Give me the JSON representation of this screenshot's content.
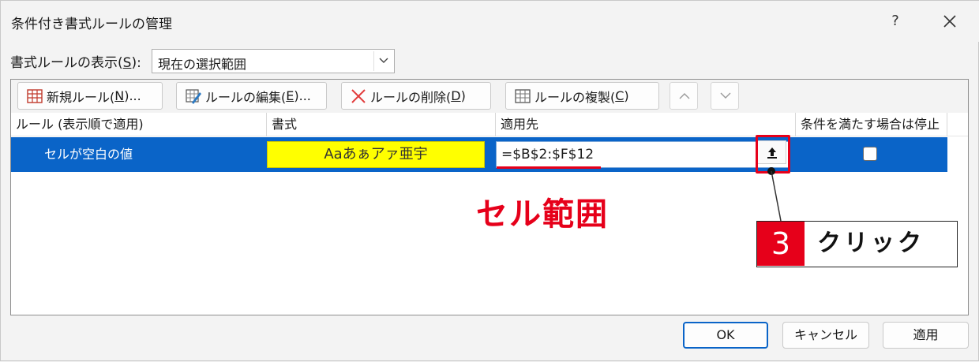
{
  "window": {
    "title": "条件付き書式ルールの管理",
    "help": "?"
  },
  "show_rules": {
    "label_prefix": "書式ルールの表示(",
    "label_key": "S",
    "label_suffix": "):",
    "selected": "現在の選択範囲"
  },
  "toolbar": {
    "new_rule": {
      "prefix": "新規ルール(",
      "key": "N",
      "suffix": ")..."
    },
    "edit_rule": {
      "prefix": "ルールの編集(",
      "key": "E",
      "suffix": ")..."
    },
    "delete_rule": {
      "prefix": "ルールの削除(",
      "key": "D",
      "suffix": ")"
    },
    "duplicate_rule": {
      "prefix": "ルールの複製(",
      "key": "C",
      "suffix": ")"
    }
  },
  "table": {
    "headers": [
      "ルール (表示順で適用)",
      "書式",
      "適用先",
      "条件を満たす場合は停止"
    ],
    "rows": [
      {
        "rule": "セルが空白の値",
        "format_preview": "Aaあぁアァ亜宇",
        "applies_to": "=$B$2:$F$12",
        "stop_if_true": false
      }
    ]
  },
  "annotations": {
    "range_label": "セル範囲",
    "step_number": "3",
    "step_text": "クリック"
  },
  "buttons": {
    "ok": "OK",
    "cancel": "キャンセル",
    "apply": "適用"
  },
  "colors": {
    "selection": "#0a64c8",
    "highlight": "#e6001a",
    "preview_fill": "#ffff00"
  }
}
